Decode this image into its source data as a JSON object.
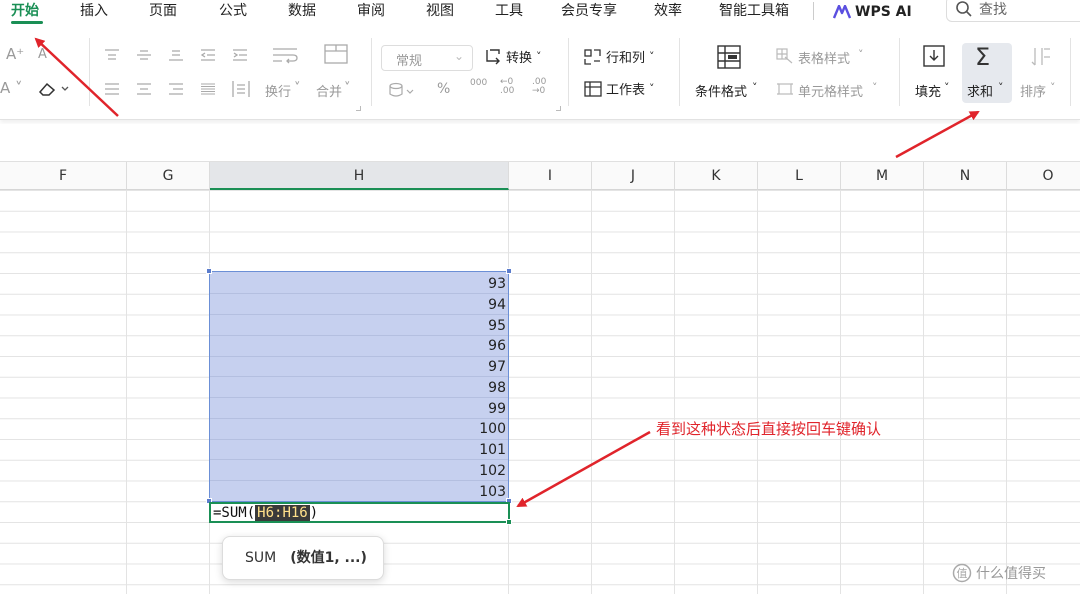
{
  "menu": {
    "tabs": [
      {
        "label": "开始",
        "active": true
      },
      {
        "label": "插入"
      },
      {
        "label": "页面"
      },
      {
        "label": "公式"
      },
      {
        "label": "数据"
      },
      {
        "label": "审阅"
      },
      {
        "label": "视图"
      },
      {
        "label": "工具"
      },
      {
        "label": "会员专享"
      },
      {
        "label": "效率"
      },
      {
        "label": "智能工具箱"
      }
    ],
    "wps_ai": "WPS AI",
    "search_placeholder": "查找"
  },
  "ribbon": {
    "wrap_text": "换行",
    "merge": "合并",
    "number_format": "常规",
    "convert": "转换",
    "rows_cols": "行和列",
    "worksheet": "工作表",
    "conditional_format": "条件格式",
    "table_style": "表格样式",
    "cell_style": "单元格样式",
    "fill": "填充",
    "sum": "求和",
    "sort": "排序",
    "percent": "%",
    "thousands": "000",
    "inc_decimal": "←0 .00",
    "dec_decimal": ".00 →0"
  },
  "columns": [
    "F",
    "G",
    "H",
    "I",
    "J",
    "K",
    "L",
    "M",
    "N",
    "O"
  ],
  "selected_column": "H",
  "cells": {
    "values": [
      "93",
      "94",
      "95",
      "96",
      "97",
      "98",
      "99",
      "100",
      "101",
      "102",
      "103"
    ]
  },
  "formula": {
    "prefix": "=SUM(",
    "range": "H6:H16",
    "suffix": ")"
  },
  "tooltip": {
    "func": "SUM",
    "args": "(数值1, ...)"
  },
  "annotation": "看到这种状态后直接按回车键确认",
  "watermark": "什么值得买",
  "colors": {
    "accent_green": "#1a8f55",
    "selection_fill": "#c6d0ef",
    "annotation_red": "#e0242b"
  }
}
